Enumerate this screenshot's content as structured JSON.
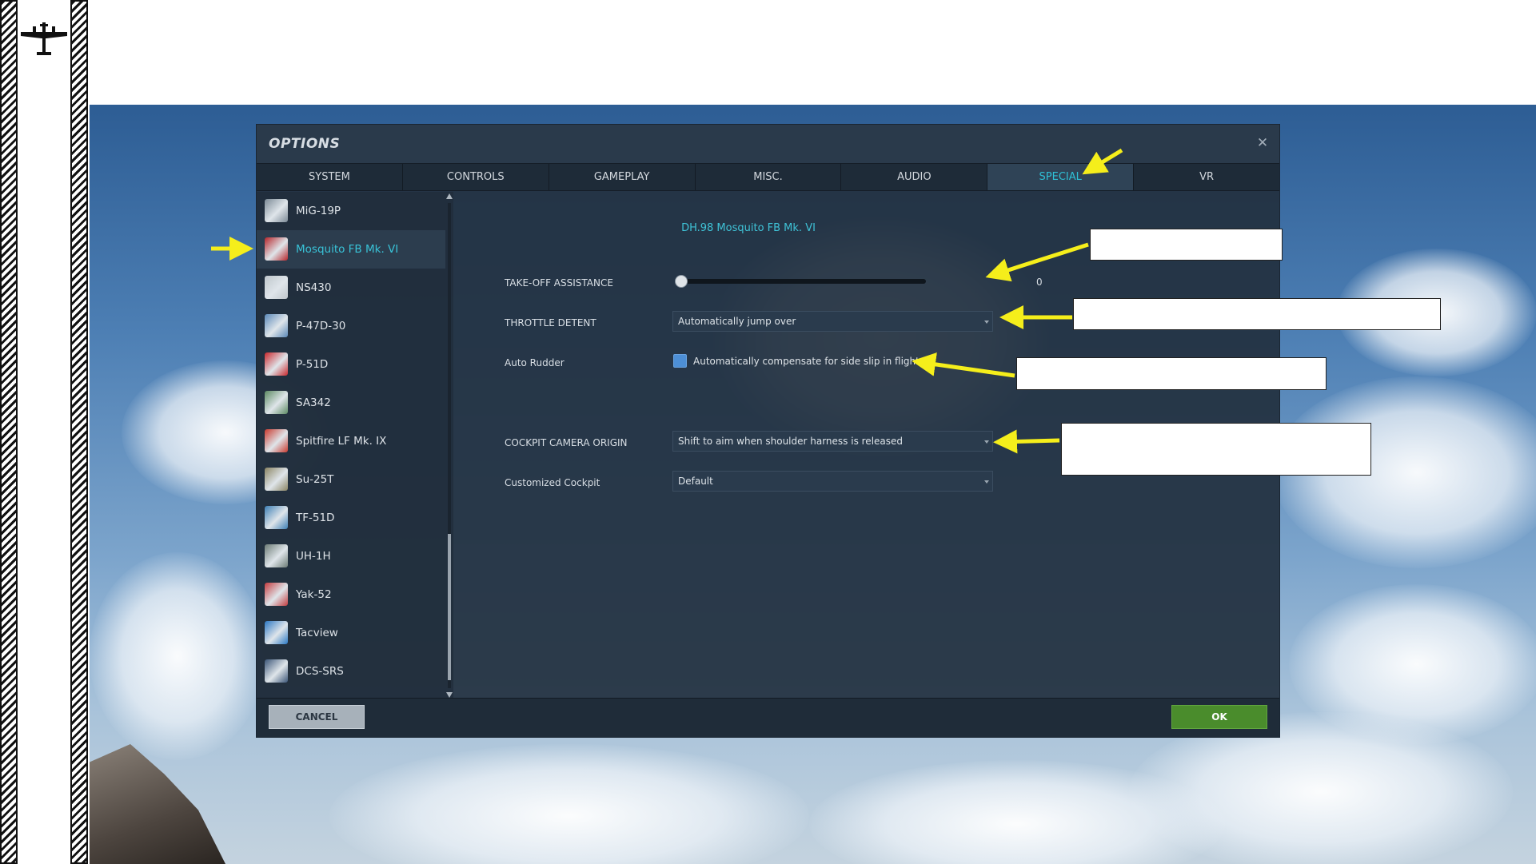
{
  "dialog": {
    "title": "OPTIONS",
    "close_icon": "close-icon"
  },
  "tabs": [
    {
      "label": "SYSTEM",
      "active": false
    },
    {
      "label": "CONTROLS",
      "active": false
    },
    {
      "label": "GAMEPLAY",
      "active": false
    },
    {
      "label": "MISC.",
      "active": false
    },
    {
      "label": "AUDIO",
      "active": false
    },
    {
      "label": "SPECIAL",
      "active": true
    },
    {
      "label": "VR",
      "active": false
    }
  ],
  "sidebar": {
    "items": [
      {
        "label": "MiG-19P",
        "icon": "mig19p-icon",
        "color": "#7c8a96"
      },
      {
        "label": "Mosquito FB Mk. VI",
        "icon": "mosquito-icon",
        "color": "#b6262b",
        "selected": true
      },
      {
        "label": "NS430",
        "icon": "ns430-icon",
        "color": "#bfc6cc"
      },
      {
        "label": "P-47D-30",
        "icon": "p47-icon",
        "color": "#5a88b8"
      },
      {
        "label": "P-51D",
        "icon": "p51d-icon",
        "color": "#c9282d"
      },
      {
        "label": "SA342",
        "icon": "sa342-icon",
        "color": "#5d8a63"
      },
      {
        "label": "Spitfire LF Mk. IX",
        "icon": "spitfire-icon",
        "color": "#c93a2f"
      },
      {
        "label": "Su-25T",
        "icon": "su25t-icon",
        "color": "#8a8463"
      },
      {
        "label": "TF-51D",
        "icon": "tf51d-icon",
        "color": "#3d7fb5"
      },
      {
        "label": "UH-1H",
        "icon": "uh1h-icon",
        "color": "#6c7b75"
      },
      {
        "label": "Yak-52",
        "icon": "yak52-icon",
        "color": "#c43c3f"
      },
      {
        "label": "Tacview",
        "icon": "tacview-icon",
        "color": "#2b78c4"
      },
      {
        "label": "DCS-SRS",
        "icon": "dcs-srs-icon",
        "color": "#3b5577"
      }
    ]
  },
  "panel": {
    "title": "DH.98 Mosquito FB Mk. VI",
    "takeoff_assistance": {
      "label": "TAKE-OFF ASSISTANCE",
      "value": "0",
      "level": 0
    },
    "throttle_detent": {
      "label": "THROTTLE DETENT",
      "selected": "Automatically jump over"
    },
    "auto_rudder": {
      "label": "Auto Rudder",
      "checkbox_label": "Automatically compensate for side slip in flight",
      "checked": true
    },
    "cockpit_camera_origin": {
      "label": "COCKPIT CAMERA ORIGIN",
      "selected": "Shift to aim when shoulder harness is released"
    },
    "customized_cockpit": {
      "label": "Customized Cockpit",
      "selected": "Default"
    }
  },
  "footer": {
    "cancel_label": "CANCEL",
    "ok_label": "OK"
  },
  "colors": {
    "accent": "#3fc2d6",
    "ok_green": "#4a8c2c",
    "arrow_yellow": "#f5ee1b"
  }
}
